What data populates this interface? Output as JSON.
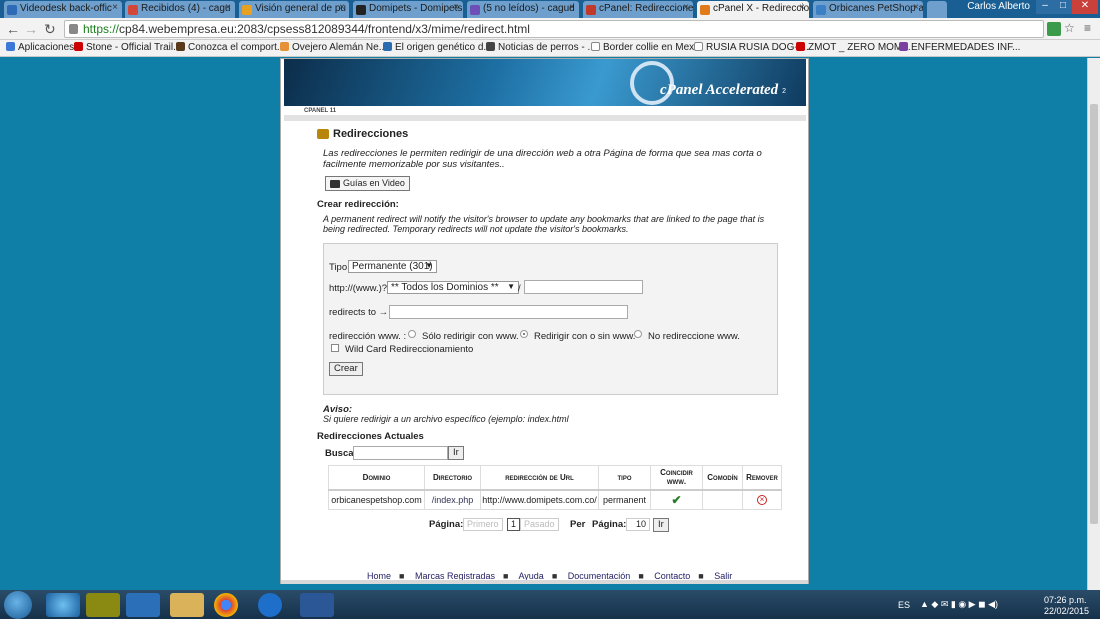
{
  "browser": {
    "tabs": [
      {
        "label": "Videodesk back-offic",
        "icon_color": "#2d6bb4"
      },
      {
        "label": "Recibidos (4) - cagu",
        "icon_color": "#d44638"
      },
      {
        "label": "Visión general de pu",
        "icon_color": "#e8a020"
      },
      {
        "label": "Domipets - Domipets",
        "icon_color": "#222222"
      },
      {
        "label": "(5 no leídos) - cagud",
        "icon_color": "#6d4fb8"
      },
      {
        "label": "cPanel: Redireccione",
        "icon_color": "#c0392b"
      },
      {
        "label": "cPanel X - Redireccio",
        "icon_color": "#e07a1a"
      },
      {
        "label": "Orbicanes PetShop a",
        "icon_color": "#3b7fc4"
      }
    ],
    "user_name": "Carlos Alberto",
    "url_secure": "https://",
    "url_rest": "cp84.webempresa.eu:2083/cpsess812089344/frontend/x3/mime/redirect.html",
    "bookmarks": [
      {
        "label": "Aplicaciones",
        "icon_color": "#3c78d8"
      },
      {
        "label": "Stone - Official Trail...",
        "icon_color": "#cc0000"
      },
      {
        "label": "Conozca el comport...",
        "icon_color": "#5a3a1a"
      },
      {
        "label": "Ovejero Alemán Ne...",
        "icon_color": "#e69138"
      },
      {
        "label": "El origen genético d...",
        "icon_color": "#2b6cb0"
      },
      {
        "label": "Noticias de perros - ...",
        "icon_color": "#444444"
      },
      {
        "label": "Border collie en Mex...",
        "icon_color": "#888888"
      },
      {
        "label": "RUSIA RUSIA DOG-r...",
        "icon_color": "#444444"
      },
      {
        "label": "ZMOT _ ZERO MOM...",
        "icon_color": "#cc0000"
      },
      {
        "label": "ENFERMEDADES INF...",
        "icon_color": "#7a3fa0"
      }
    ]
  },
  "banner": {
    "brand": "cPanel Accelerated",
    "brand_sub": "2",
    "caption": "CPANEL 11"
  },
  "section": {
    "title": "Redirecciones",
    "intro": "Las redirecciones le permiten redirigir de una dirección web a otra Página de forma que sea mas corta o facilmente memorizable por sus visitantes..",
    "video_button": "Guías en Video",
    "create_title": "Crear redirección:",
    "create_desc": "A permanent redirect will notify the visitor's browser to update any bookmarks that are linked to the page that is being redirected. Temporary redirects will not update the visitor's bookmarks."
  },
  "form": {
    "type_label": "Tipo",
    "type_value": "Permanente (301)",
    "http_label": "http://(www.)?",
    "domain_value": "** Todos los Dominios **",
    "slash": "/",
    "redirects_to_label": "redirects to →",
    "www_label": "redirección www. :",
    "radio_options": [
      "Sólo redirigir con www.",
      "Redirigir con o sin www.",
      "No redireccione www."
    ],
    "selected_radio": 1,
    "wildcard_label": "Wild Card Redireccionamiento",
    "submit_label": "Crear"
  },
  "notice": {
    "title": "Aviso:",
    "text": "Si quiere redirigir a un archivo específico (ejemplo: index.html"
  },
  "current": {
    "title": "Redirecciones Actuales",
    "search_label": "Buscar",
    "search_button": "Ir",
    "columns": [
      "Dominio",
      "Directorio",
      "redirección de Url",
      "tipo",
      "Coincidir www.",
      "Comodín",
      "Remover"
    ],
    "rows": [
      {
        "domain": "orbicanespetshop.com",
        "directory": "/index.php",
        "url": "http://www.domipets.com.co/",
        "type": "permanent",
        "match_www": "✔",
        "wildcard": "",
        "remove": "×"
      }
    ]
  },
  "pagination": {
    "page_label": "Página:",
    "first_label": "Primero",
    "current_page": "1",
    "last_label": "Pasado",
    "per_page_label": "Per",
    "per_page_label2": "Página:",
    "per_page_value": "10",
    "go_label": "Ir"
  },
  "footer": {
    "links": [
      "Home",
      "Marcas Registradas",
      "Ayuda",
      "Documentación",
      "Contacto",
      "Salir"
    ]
  },
  "taskbar": {
    "language": "ES",
    "time": "07:26 p.m.",
    "date": "22/02/2015"
  }
}
